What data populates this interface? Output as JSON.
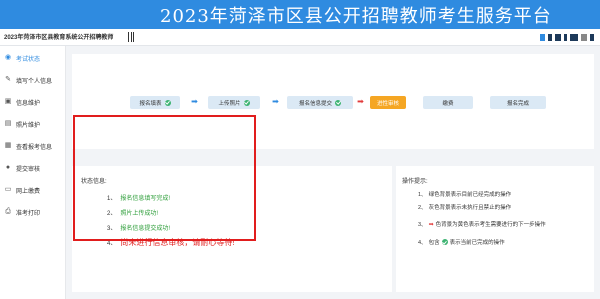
{
  "banner": {
    "title": "2023年菏泽市区县公开招聘教师考生服务平台"
  },
  "topbar": {
    "title": "2023年菏泽市区县教育系统公开招聘教师"
  },
  "sidebar": {
    "items": [
      {
        "label": "考试状态",
        "icon": "status-icon",
        "active": true
      },
      {
        "label": "填写个人信息",
        "icon": "edit-icon",
        "active": false
      },
      {
        "label": "信息维护",
        "icon": "info-icon",
        "active": false
      },
      {
        "label": "照片维护",
        "icon": "photo-icon",
        "active": false
      },
      {
        "label": "查看报考信息",
        "icon": "view-icon",
        "active": false
      },
      {
        "label": "提交审核",
        "icon": "submit-icon",
        "active": false
      },
      {
        "label": "网上缴费",
        "icon": "pay-icon",
        "active": false
      },
      {
        "label": "准考打印",
        "icon": "print-icon",
        "active": false
      }
    ]
  },
  "steps": [
    {
      "label": "报名填表",
      "done": true
    },
    {
      "label": "上传照片",
      "done": true
    },
    {
      "label": "报名信息提交",
      "done": true
    },
    {
      "label": "进性审核",
      "done": false,
      "current": true
    },
    {
      "label": "缴费",
      "done": false
    },
    {
      "label": "报名完成",
      "done": false
    }
  ],
  "status": {
    "title": "状态信息:",
    "rows": [
      {
        "num": "1、",
        "text": "报名信息填写完成!"
      },
      {
        "num": "2、",
        "text": "照片上传成功!"
      },
      {
        "num": "3、",
        "text": "报名信息提交成功!"
      },
      {
        "num": "4、",
        "text": "尚未进行信息审核，请耐心等待!"
      }
    ]
  },
  "hints": {
    "title": "操作提示:",
    "rows": [
      {
        "num": "1、",
        "text": "绿色背景表示目前已经完成的操作"
      },
      {
        "num": "2、",
        "text": "灰色背景表示未执行且禁止的操作"
      },
      {
        "num": "3、",
        "pre": "",
        "text": "色背景为黄色表示考生需要进行的下一步操作"
      },
      {
        "num": "4、",
        "pre": "包含",
        "text": "表示当前已完成的操作"
      }
    ]
  },
  "colors": {
    "accent": "#2f8be0",
    "current": "#f5a623",
    "done": "#3cb371",
    "alert": "#e02020"
  }
}
